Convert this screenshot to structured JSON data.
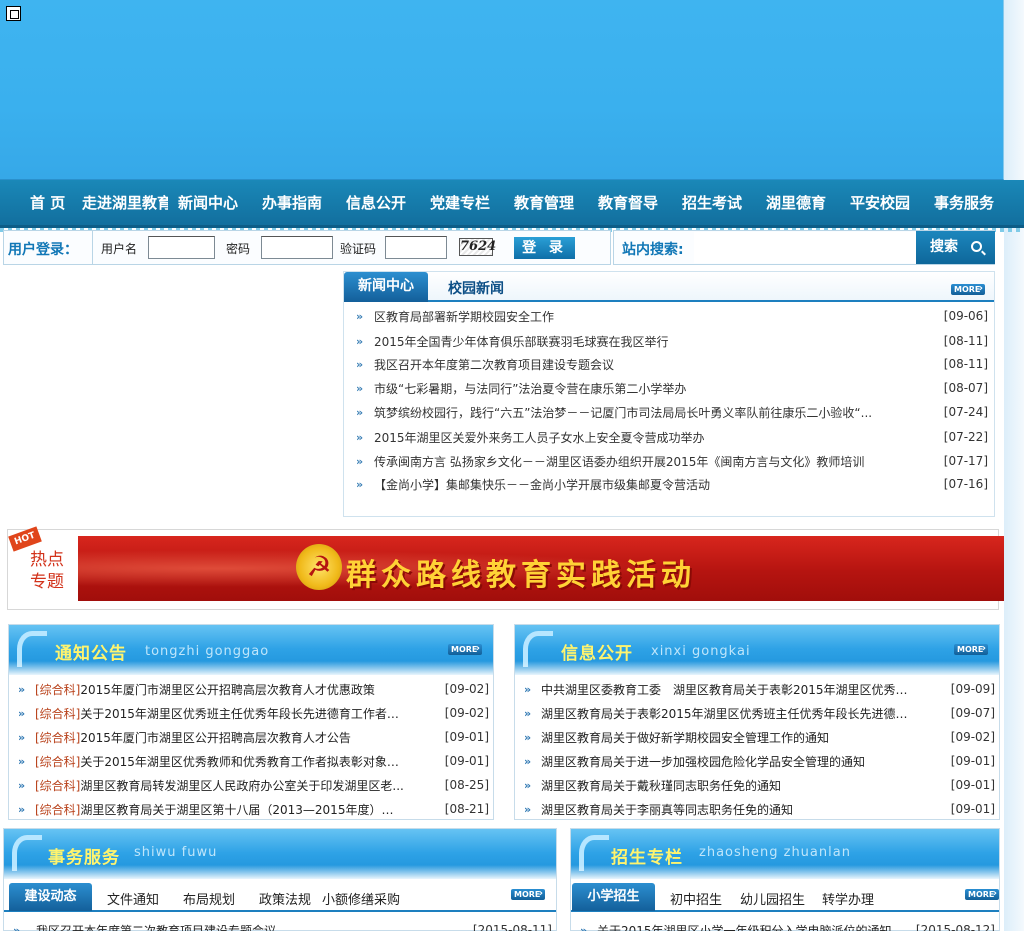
{
  "nav": {
    "items": [
      "首 页",
      "走进湖里教育",
      "新闻中心",
      "办事指南",
      "信息公开",
      "党建专栏",
      "教育管理",
      "教育督导",
      "招生考试",
      "湖里德育",
      "平安校园",
      "事务服务"
    ]
  },
  "login": {
    "title": "用户登录：",
    "username_label": "用户名",
    "password_label": "密码",
    "captcha_label": "验证码",
    "captcha_value": "7624",
    "button": "登 录"
  },
  "search": {
    "title": "站内搜索:",
    "button": "搜索"
  },
  "news": {
    "tab_active": "新闻中心",
    "tab_2": "校园新闻",
    "more": "MORE",
    "items": [
      {
        "title": "区教育局部署新学期校园安全工作",
        "date": "[09-06]"
      },
      {
        "title": "2015年全国青少年体育俱乐部联赛羽毛球赛在我区举行",
        "date": "[08-11]"
      },
      {
        "title": "我区召开本年度第二次教育项目建设专题会议",
        "date": "[08-11]"
      },
      {
        "title": "市级“七彩暑期，与法同行”法治夏令营在康乐第二小学举办",
        "date": "[08-07]"
      },
      {
        "title": "筑梦缤纷校园行，践行“六五”法治梦－－记厦门市司法局局长叶勇义率队前往康乐二小验收“...",
        "date": "[07-24]"
      },
      {
        "title": "2015年湖里区关爱外来务工人员子女水上安全夏令营成功举办",
        "date": "[07-22]"
      },
      {
        "title": "传承闽南方言 弘扬家乡文化－－湖里区语委办组织开展2015年《闽南方言与文化》教师培训",
        "date": "[07-17]"
      },
      {
        "title": "【金尚小学】集邮集快乐－－金尚小学开展市级集邮夏令营活动",
        "date": "[07-16]"
      }
    ]
  },
  "hot": {
    "badge": "HOT",
    "label": "热点专题",
    "banner_text": "群众路线教育实践活动"
  },
  "notice": {
    "title": "通知公告",
    "subtitle": "tongzhi gonggao",
    "more": "MORE",
    "items": [
      {
        "cat": "[综合科]",
        "title": "2015年厦门市湖里区公开招聘高层次教育人才优惠政策",
        "date": "[09-02]"
      },
      {
        "cat": "[综合科]",
        "title": "关于2015年湖里区优秀班主任优秀年段长先进德育工作者拟...",
        "date": "[09-02]"
      },
      {
        "cat": "[综合科]",
        "title": "2015年厦门市湖里区公开招聘高层次教育人才公告",
        "date": "[09-01]"
      },
      {
        "cat": "[综合科]",
        "title": "关于2015年湖里区优秀教师和优秀教育工作者拟表彰对象公...",
        "date": "[09-01]"
      },
      {
        "cat": "[综合科]",
        "title": "湖里区教育局转发湖里区人民政府办公室关于印发湖里区老...",
        "date": "[08-25]"
      },
      {
        "cat": "[综合科]",
        "title": "湖里区教育局关于湖里区第十八届（2013—2015年度）文明...",
        "date": "[08-21]"
      }
    ]
  },
  "info": {
    "title": "信息公开",
    "subtitle": "xinxi gongkai",
    "more": "MORE",
    "items": [
      {
        "title": "中共湖里区委教育工委　湖里区教育局关于表彰2015年湖里区优秀教...",
        "date": "[09-09]"
      },
      {
        "title": "湖里区教育局关于表彰2015年湖里区优秀班主任优秀年段长先进德育...",
        "date": "[09-07]"
      },
      {
        "title": "湖里区教育局关于做好新学期校园安全管理工作的通知",
        "date": "[09-02]"
      },
      {
        "title": "湖里区教育局关于进一步加强校园危险化学品安全管理的通知",
        "date": "[09-01]"
      },
      {
        "title": "湖里区教育局关于戴秋瑾同志职务任免的通知",
        "date": "[09-01]"
      },
      {
        "title": "湖里区教育局关于李丽真等同志职务任免的通知",
        "date": "[09-01]"
      }
    ]
  },
  "affairs": {
    "title": "事务服务",
    "subtitle": "shiwu fuwu",
    "more": "MORE",
    "tabs": [
      "建设动态",
      "文件通知",
      "布局规划",
      "政策法规",
      "小额修缮采购"
    ],
    "items": [
      {
        "title": "我区召开本年度第二次教育项目建设专题会议",
        "date": "[2015-08-11]"
      }
    ]
  },
  "enroll": {
    "title": "招生专栏",
    "subtitle": "zhaosheng zhuanlan",
    "more": "MORE",
    "tabs": [
      "小学招生",
      "初中招生",
      "幼儿园招生",
      "转学办理"
    ],
    "items": [
      {
        "title": "关于2015年湖里区小学一年级积分入学电脑派位的通知",
        "date": "[2015-08-12]"
      }
    ]
  }
}
